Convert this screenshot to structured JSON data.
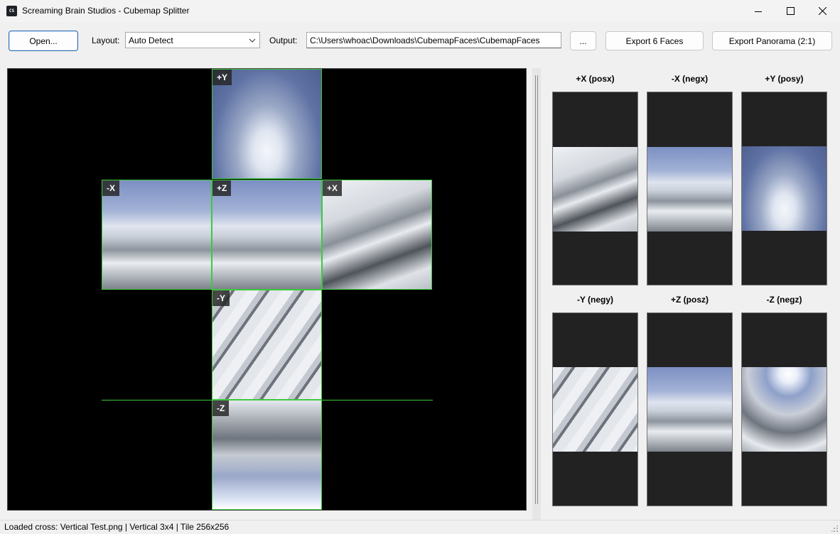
{
  "window": {
    "title": "Screaming Brain Studios - Cubemap Splitter",
    "app_icon_text": "CS"
  },
  "toolbar": {
    "open_label": "Open...",
    "layout_label": "Layout:",
    "layout_value": "Auto Detect",
    "output_label": "Output:",
    "output_value": "C:\\Users\\whoac\\Downloads\\CubemapFaces\\CubemapFaces",
    "browse_label": "...",
    "export_faces_label": "Export 6 Faces",
    "export_panorama_label": "Export Panorama (2:1)"
  },
  "canvas": {
    "tiles": [
      {
        "label": "+Y"
      },
      {
        "label": "-X"
      },
      {
        "label": "+Z"
      },
      {
        "label": "+X"
      },
      {
        "label": "-Y"
      },
      {
        "label": "-Z"
      }
    ]
  },
  "preview": {
    "faces": [
      {
        "title": "+X (posx)"
      },
      {
        "title": "-X (negx)"
      },
      {
        "title": "+Y (posy)"
      },
      {
        "title": "-Y (negy)"
      },
      {
        "title": "+Z (posz)"
      },
      {
        "title": "-Z (negz)"
      }
    ]
  },
  "status": {
    "text": "Loaded cross: Vertical Test.png | Vertical 3x4 | Tile 256x256"
  },
  "colors": {
    "grid": "#3ec93e",
    "canvas_bg": "#000000",
    "preview_face_bg": "#222222",
    "primary_button_border": "#2a6cb5"
  }
}
